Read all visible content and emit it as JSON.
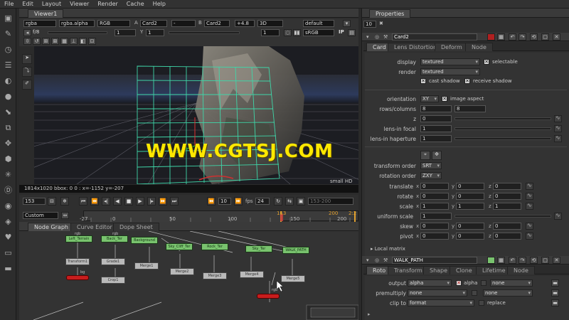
{
  "menu": [
    "File",
    "Edit",
    "Layout",
    "Viewer",
    "Render",
    "Cache",
    "Help"
  ],
  "viewer": {
    "tab": "Viewer1",
    "channels": "rgba",
    "alpha": "rgba.alpha",
    "colorspace": "RGB",
    "input_a_label": "A",
    "input_a": "Card2",
    "dash": "-",
    "input_b_label": "B",
    "input_b": "Card2",
    "gain": "+4.8",
    "view_mode": "3D",
    "default_label": "default",
    "fstop": "f/8",
    "frame_field": "1",
    "y_label": "Y",
    "y_value": "1",
    "proxy": "1",
    "lut": "sRGB",
    "ip": "IP",
    "info": "1814x1020  bbox: 0 0 :  x=-1152 y=-207",
    "small_hd": "small HD",
    "frame": "153",
    "fps_label": "fps",
    "fps": "24",
    "skip": "10",
    "range": "153-200",
    "range_mode": "Custom",
    "timeline_ticks": [
      "-27",
      "0",
      "50",
      "100",
      "150",
      "200",
      "2:2"
    ],
    "marker_left": "153",
    "marker_right": "200"
  },
  "node_graph": {
    "tabs": [
      "Node Graph",
      "Curve Editor",
      "Dope Sheet"
    ],
    "nodes_green": [
      "Left_Terrain",
      "Back_Ter",
      "Background",
      "Sky_Cliff_Ter",
      "Rock_Ter",
      "Sky_Ter",
      "WALK_PATH"
    ],
    "nodes_gray": [
      "Transform1",
      "Grade1",
      "Merge1",
      "Merge2",
      "Merge3",
      "Merge4",
      "Merge5",
      "Crop1"
    ],
    "labels": [
      "rgb",
      "rgb",
      "bg",
      "rgb"
    ]
  },
  "properties": {
    "title": "Properties",
    "count": "10",
    "card_node": {
      "name": "Card2",
      "tabs": [
        "Card",
        "Lens Distortion",
        "Deform",
        "Node"
      ],
      "display_label": "display",
      "display": "textured",
      "selectable_label": "selectable",
      "render_label": "render",
      "render": "textured",
      "cast_shadow": "cast shadow",
      "receive_shadow": "receive shadow",
      "orientation_label": "orientation",
      "orientation": "XY",
      "image_aspect": "image aspect",
      "rows_label": "rows/columns",
      "rows": "8",
      "columns": "8",
      "z_label": "z",
      "z": "0",
      "lens_focal_label": "lens-in focal",
      "lens_focal": "1",
      "lens_haperture_label": "lens-in haperture",
      "lens_haperture": "1",
      "transform_order_label": "transform order",
      "transform_order": "SRT",
      "rotation_order_label": "rotation order",
      "rotation_order": "ZXY",
      "translate_label": "translate",
      "rotate_label": "rotate",
      "scale_label": "scale",
      "uniform_scale_label": "uniform scale",
      "skew_label": "skew",
      "pivot_label": "pivot",
      "axis_x": "x",
      "axis_y": "y",
      "axis_z": "z",
      "translate": [
        "0",
        "0",
        "0"
      ],
      "rotate": [
        "0",
        "0",
        "0"
      ],
      "scale": [
        "1",
        "1",
        "1"
      ],
      "uniform_scale": "1",
      "skew": [
        "0",
        "0",
        "0"
      ],
      "pivot": [
        "0",
        "0",
        "0"
      ],
      "local_matrix": "Local matrix"
    },
    "roto_node": {
      "name": "WALK_PATH",
      "tabs": [
        "Roto",
        "Transform",
        "Shape",
        "Clone",
        "Lifetime",
        "Node"
      ],
      "output_label": "output",
      "output": "alpha",
      "alpha_label": "alpha",
      "output_b": "none",
      "premultiply_label": "premultiply",
      "premultiply": "none",
      "premultiply_b": "none",
      "clip_label": "clip to",
      "clip": "format",
      "replace": "replace"
    }
  },
  "watermark": "WWW.CGTSJ.COM",
  "colors": {
    "node_green": "#79c36e",
    "node_red": "#c71d1d",
    "accent_red": "#b02020",
    "grid": "#3fd6a8",
    "watermark": "#ffe800"
  }
}
